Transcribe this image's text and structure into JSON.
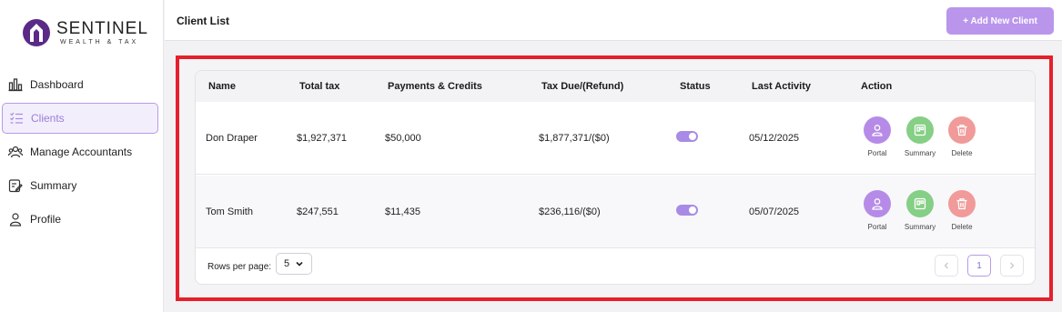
{
  "brand": {
    "name": "SENTINEL",
    "tagline": "WEALTH & TAX",
    "color": "#5b2a86"
  },
  "sidebar": {
    "items": [
      {
        "label": "Dashboard",
        "icon": "bar-chart-icon",
        "active": false
      },
      {
        "label": "Clients",
        "icon": "list-check-icon",
        "active": true
      },
      {
        "label": "Manage Accountants",
        "icon": "users-icon",
        "active": false
      },
      {
        "label": "Summary",
        "icon": "edit-note-icon",
        "active": false
      },
      {
        "label": "Profile",
        "icon": "user-icon",
        "active": false
      }
    ]
  },
  "header": {
    "title": "Client List",
    "add_button": "+ Add New Client"
  },
  "table": {
    "columns": [
      "Name",
      "Total tax",
      "Payments & Credits",
      "Tax Due/(Refund)",
      "Status",
      "Last Activity",
      "Action"
    ],
    "rows": [
      {
        "name": "Don Draper",
        "total_tax": "$1,927,371",
        "payments": "$50,000",
        "tax_due": "$1,877,371/($0)",
        "status_on": true,
        "last_activity": "05/12/2025"
      },
      {
        "name": "Tom Smith",
        "total_tax": "$247,551",
        "payments": "$11,435",
        "tax_due": "$236,116/($0)",
        "status_on": true,
        "last_activity": "05/07/2025"
      }
    ],
    "actions": {
      "portal": "Portal",
      "summary": "Summary",
      "delete": "Delete"
    }
  },
  "pagination": {
    "rows_per_page_label": "Rows per page:",
    "rows_per_page_value": "5",
    "current_page": "1"
  },
  "colors": {
    "accent": "#b996ec",
    "portal": "#b68be8",
    "summary": "#86cf86",
    "delete": "#f19a9a",
    "highlight_frame": "#e5202c"
  }
}
